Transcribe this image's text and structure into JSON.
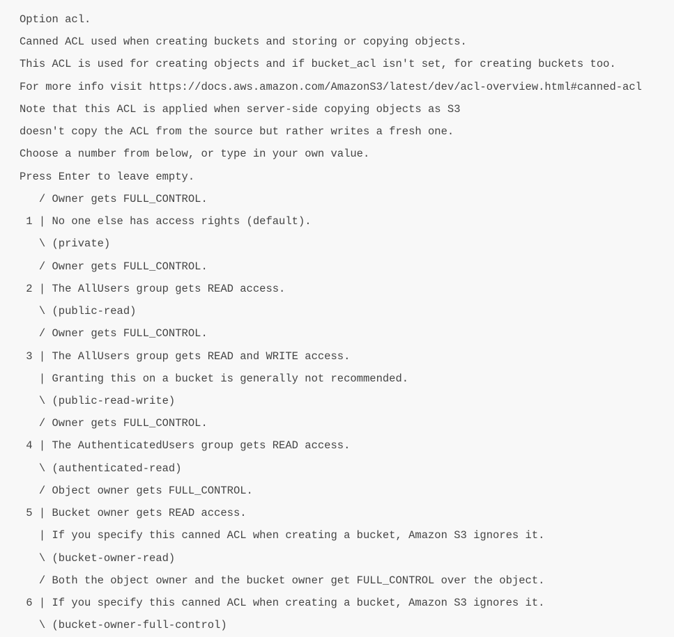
{
  "lines": [
    "Option acl.",
    "Canned ACL used when creating buckets and storing or copying objects.",
    "This ACL is used for creating objects and if bucket_acl isn't set, for creating buckets too.",
    "For more info visit https://docs.aws.amazon.com/AmazonS3/latest/dev/acl-overview.html#canned-acl",
    "Note that this ACL is applied when server-side copying objects as S3",
    "doesn't copy the ACL from the source but rather writes a fresh one.",
    "Choose a number from below, or type in your own value.",
    "Press Enter to leave empty.",
    "   / Owner gets FULL_CONTROL.",
    " 1 | No one else has access rights (default).",
    "   \\ (private)",
    "   / Owner gets FULL_CONTROL.",
    " 2 | The AllUsers group gets READ access.",
    "   \\ (public-read)",
    "   / Owner gets FULL_CONTROL.",
    " 3 | The AllUsers group gets READ and WRITE access.",
    "   | Granting this on a bucket is generally not recommended.",
    "   \\ (public-read-write)",
    "   / Owner gets FULL_CONTROL.",
    " 4 | The AuthenticatedUsers group gets READ access.",
    "   \\ (authenticated-read)",
    "   / Object owner gets FULL_CONTROL.",
    " 5 | Bucket owner gets READ access.",
    "   | If you specify this canned ACL when creating a bucket, Amazon S3 ignores it.",
    "   \\ (bucket-owner-read)",
    "   / Both the object owner and the bucket owner get FULL_CONTROL over the object.",
    " 6 | If you specify this canned ACL when creating a bucket, Amazon S3 ignores it.",
    "   \\ (bucket-owner-full-control)"
  ]
}
